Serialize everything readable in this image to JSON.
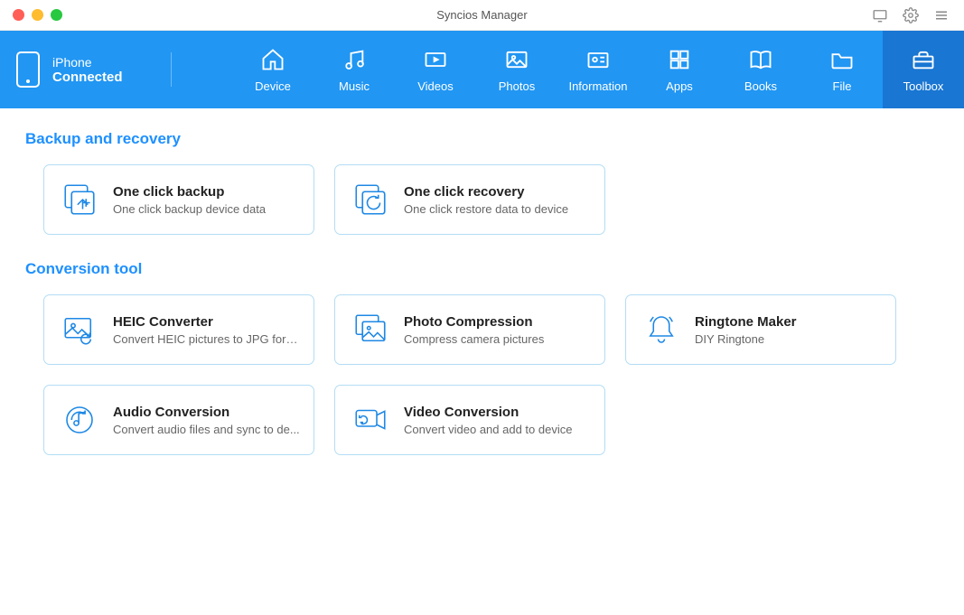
{
  "window": {
    "title": "Syncios Manager"
  },
  "device": {
    "name": "iPhone",
    "status": "Connected"
  },
  "nav": {
    "device": "Device",
    "music": "Music",
    "videos": "Videos",
    "photos": "Photos",
    "information": "Information",
    "apps": "Apps",
    "books": "Books",
    "file": "File",
    "toolbox": "Toolbox"
  },
  "sections": {
    "backup": {
      "title": "Backup and recovery",
      "cards": [
        {
          "title": "One click backup",
          "desc": "One click backup device data"
        },
        {
          "title": "One click recovery",
          "desc": "One click restore data to device"
        }
      ]
    },
    "conversion": {
      "title": "Conversion tool",
      "cards": [
        {
          "title": "HEIC Converter",
          "desc": "Convert HEIC pictures to JPG format"
        },
        {
          "title": "Photo Compression",
          "desc": "Compress camera pictures"
        },
        {
          "title": "Ringtone Maker",
          "desc": "DIY Ringtone"
        },
        {
          "title": "Audio Conversion",
          "desc": "Convert audio files and sync to de..."
        },
        {
          "title": "Video Conversion",
          "desc": "Convert video and add to device"
        }
      ]
    }
  }
}
